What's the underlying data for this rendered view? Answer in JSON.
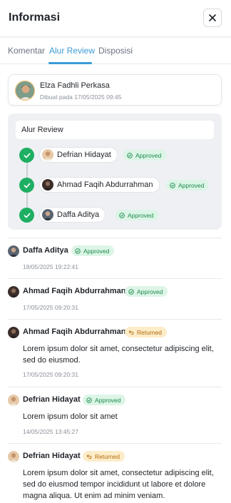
{
  "header": {
    "title": "Informasi"
  },
  "tabs": [
    {
      "label": "Komentar",
      "active": false
    },
    {
      "label": "Alur Review",
      "active": true
    },
    {
      "label": "Disposisi",
      "active": false
    }
  ],
  "creator": {
    "name": "Elza Fadhli Perkasa",
    "meta": "Dibuat pada 17/05/2025 09:45"
  },
  "review_flow": {
    "title": "Alur Review",
    "steps": [
      {
        "name": "Defrian Hidayat",
        "status": "Approved"
      },
      {
        "name": "Ahmad Faqih Abdurrahman",
        "status": "Approved"
      },
      {
        "name": "Daffa Aditya",
        "status": "Approved"
      }
    ]
  },
  "history": [
    {
      "name": "Daffa Aditya",
      "status": "Approved",
      "note": "",
      "timestamp": "18/05/2025 19:22:41"
    },
    {
      "name": "Ahmad Faqih Abdurrahman",
      "status": "Approved",
      "note": "",
      "timestamp": "17/05/2025 09:20:31"
    },
    {
      "name": "Ahmad Faqih Abdurrahman",
      "status": "Returned",
      "note": "Lorem ipsum dolor sit amet, consectetur adipiscing elit, sed do eiusmod.",
      "timestamp": "17/05/2025 09:20:31"
    },
    {
      "name": "Defrian Hidayat",
      "status": "Approved",
      "note": "Lorem ipsum dolor sit amet",
      "timestamp": "14/05/2025 13:45:27"
    },
    {
      "name": "Defrian Hidayat",
      "status": "Returned",
      "note": "Lorem ipsum dolor sit amet, consectetur adipiscing elit, sed do eiusmod tempor incididunt ut labore et dolore magna aliqua. Ut enim ad minim veniam.",
      "timestamp": ""
    }
  ],
  "colors": {
    "accent": "#3b9bd6",
    "approved": "#1eaf62",
    "approved_bg": "#dcf5e6",
    "returned": "#b26b0c",
    "returned_bg": "#fdecc8"
  },
  "icons": {
    "close": "close-icon",
    "check": "check-icon",
    "approved": "check-circle-icon",
    "returned": "undo-arrow-icon"
  }
}
